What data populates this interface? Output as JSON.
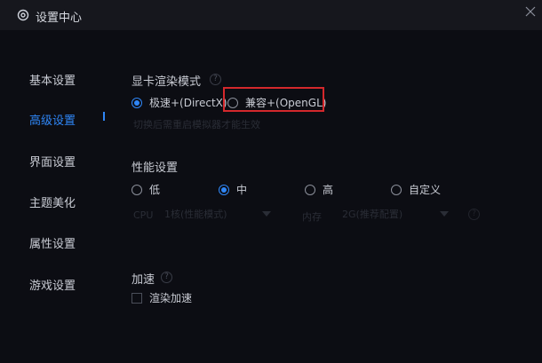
{
  "window": {
    "title": "设置中心",
    "title_icon": "gear-icon",
    "close_icon": "close-icon"
  },
  "sidebar": {
    "items": [
      {
        "label": "基本设置",
        "active": false
      },
      {
        "label": "高级设置",
        "active": true
      },
      {
        "label": "界面设置",
        "active": false
      },
      {
        "label": "主题美化",
        "active": false
      },
      {
        "label": "属性设置",
        "active": false
      },
      {
        "label": "游戏设置",
        "active": false
      }
    ]
  },
  "graphics": {
    "title": "显卡渲染模式",
    "help": "?",
    "options": [
      {
        "label": "极速+(DirectX)",
        "checked": true
      },
      {
        "label": "兼容+(OpenGL)",
        "checked": false
      }
    ],
    "note": "切换后需重启模拟器才能生效"
  },
  "performance": {
    "title": "性能设置",
    "options": [
      {
        "label": "低",
        "checked": false
      },
      {
        "label": "中",
        "checked": true
      },
      {
        "label": "高",
        "checked": false
      },
      {
        "label": "自定义",
        "checked": false
      }
    ],
    "cpu_label": "CPU",
    "cpu_value": "1核(性能模式)",
    "mem_label": "内存",
    "mem_value": "2G(推荐配置)",
    "help": "?"
  },
  "accel": {
    "title": "加速",
    "help": "?",
    "checkbox_label": "渲染加速",
    "checked": false
  },
  "colors": {
    "accent": "#2f86f6",
    "highlight": "#d4282c",
    "background": "#0c0d13"
  }
}
